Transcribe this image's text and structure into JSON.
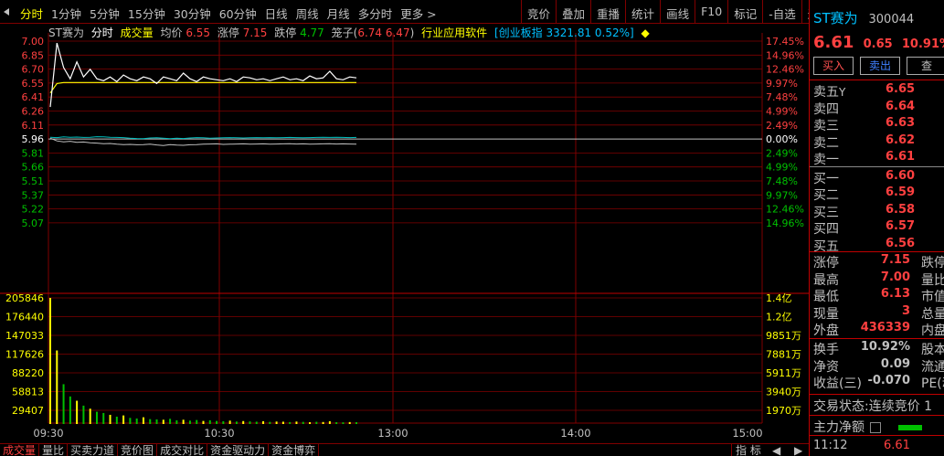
{
  "toolbar": {
    "periods": [
      "分时",
      "1分钟",
      "5分钟",
      "15分钟",
      "30分钟",
      "60分钟",
      "日线",
      "周线",
      "月线",
      "多分时",
      "更多 >"
    ],
    "active_period": 0,
    "tools": [
      "竞价",
      "叠加",
      "重播",
      "统计",
      "画线",
      "F10",
      "标记",
      "-自选",
      "返回"
    ]
  },
  "info_bar": {
    "stock_name": "ST赛为",
    "chart_mode": "分时",
    "volume_label": "成交量",
    "avg_label": "均价",
    "avg_value": "6.55",
    "limit_up_label": "涨停",
    "limit_up_value": "7.15",
    "limit_down_label": "跌停",
    "limit_down_value": "4.77",
    "cage_label": "笼子(",
    "cage_values": "6.74 6.47",
    "cage_close": ")",
    "industry": "行业应用软件",
    "index_text": "[创业板指",
    "index_value": "3321.81 0.52%]"
  },
  "right_panel": {
    "stock_name": "ST赛为",
    "stock_code": "300044",
    "price": "6.61",
    "change": "0.65",
    "change_pct": "10.91%",
    "buy_button": "买入",
    "sell_button": "卖出",
    "query_button": "查",
    "asks": [
      {
        "label": "卖五",
        "tag": "Y",
        "price": "6.65"
      },
      {
        "label": "卖四",
        "price": "6.64"
      },
      {
        "label": "卖三",
        "price": "6.63"
      },
      {
        "label": "卖二",
        "price": "6.62"
      },
      {
        "label": "卖一",
        "price": "6.61"
      }
    ],
    "bids": [
      {
        "label": "买一",
        "price": "6.60"
      },
      {
        "label": "买二",
        "price": "6.59"
      },
      {
        "label": "买三",
        "price": "6.58"
      },
      {
        "label": "买四",
        "price": "6.57"
      },
      {
        "label": "买五",
        "price": "6.56"
      }
    ],
    "stats_a": [
      {
        "label": "涨停",
        "value": "7.15",
        "r2": "跌停"
      },
      {
        "label": "最高",
        "value": "7.00",
        "r2": "量比"
      },
      {
        "label": "最低",
        "value": "6.13",
        "r2": "市值"
      },
      {
        "label": "现量",
        "value": "3",
        "r2": "总量"
      },
      {
        "label": "外盘",
        "value": "436339",
        "r2": "内盘"
      }
    ],
    "stats_b": [
      {
        "label": "换手",
        "value": "10.92%",
        "r2": "股本"
      },
      {
        "label": "净资",
        "value": "0.09",
        "r2": "流通"
      },
      {
        "label": "收益(三)",
        "value": "-0.070",
        "r2": "PE(动"
      }
    ],
    "trade_status_label": "交易状态:",
    "trade_status_value": "连续竞价 1",
    "net_flow_label": "主力净额",
    "last_time": "11:12",
    "last_price": "6.61"
  },
  "chart_data": {
    "type": "line",
    "price_axis_left": [
      "7.00",
      "6.85",
      "6.70",
      "6.55",
      "6.41",
      "6.26",
      "6.11",
      "5.96",
      "5.81",
      "5.66",
      "5.51",
      "5.37",
      "5.22",
      "5.07"
    ],
    "price_axis_right": [
      "17.45%",
      "14.96%",
      "12.46%",
      "9.97%",
      "7.48%",
      "4.99%",
      "2.49%",
      "0.00%",
      "2.49%",
      "4.99%",
      "7.48%",
      "9.97%",
      "12.46%",
      "14.96%"
    ],
    "prev_close": 5.96,
    "volume_axis_left": [
      "205846",
      "176440",
      "147033",
      "117626",
      "88220",
      "58813",
      "29407"
    ],
    "volume_axis_right": [
      "1.4亿",
      "1.2亿",
      "9851万",
      "7881万",
      "5911万",
      "3940万",
      "1970万"
    ],
    "time_labels": [
      "09:30",
      "10:30",
      "13:00",
      "14:00",
      "15:00"
    ],
    "price_series": [
      6.3,
      6.98,
      6.72,
      6.6,
      6.78,
      6.62,
      6.7,
      6.6,
      6.58,
      6.62,
      6.57,
      6.64,
      6.6,
      6.58,
      6.62,
      6.6,
      6.55,
      6.62,
      6.6,
      6.58,
      6.66,
      6.6,
      6.57,
      6.62,
      6.6,
      6.59,
      6.58,
      6.6,
      6.57,
      6.62,
      6.61,
      6.59,
      6.6,
      6.58,
      6.6,
      6.62,
      6.59,
      6.6,
      6.58,
      6.63,
      6.6,
      6.61,
      6.68,
      6.6,
      6.59,
      6.62,
      6.61
    ],
    "avg_series": [
      6.45,
      6.55,
      6.56,
      6.56,
      6.56,
      6.56,
      6.56,
      6.56,
      6.56,
      6.56,
      6.56,
      6.56,
      6.56,
      6.56,
      6.56,
      6.56,
      6.56,
      6.56,
      6.56,
      6.56,
      6.56,
      6.56,
      6.56,
      6.56,
      6.56,
      6.56,
      6.56,
      6.56,
      6.56,
      6.56,
      6.56,
      6.56,
      6.56,
      6.56,
      6.56,
      6.56,
      6.56,
      6.56,
      6.56,
      6.56,
      6.56,
      6.56,
      6.56,
      6.56,
      6.56,
      6.56,
      6.56
    ],
    "index_series": [
      0.1,
      0.08,
      0.12,
      0.1,
      0.11,
      0.09,
      0.1,
      0.13,
      0.12,
      0.1,
      0.09,
      0.08,
      0.05,
      0.03,
      0.02,
      0.06,
      0.07,
      0.05,
      0.02,
      0.05,
      0.03,
      0.06,
      0.08,
      0.07,
      0.05,
      0.06,
      0.07,
      0.08,
      0.07,
      0.06,
      0.07,
      0.08,
      0.07,
      0.08,
      0.07,
      0.08,
      0.09,
      0.08,
      0.07,
      0.08,
      0.09,
      0.1,
      0.09,
      0.1,
      0.09,
      0.08,
      0.09
    ],
    "index2_series": [
      0.05,
      -0.1,
      -0.15,
      -0.12,
      -0.18,
      -0.16,
      -0.2,
      -0.22,
      -0.25,
      -0.24,
      -0.28,
      -0.3,
      -0.29,
      -0.31,
      -0.3,
      -0.28,
      -0.32,
      -0.35,
      -0.3,
      -0.33,
      -0.34,
      -0.31,
      -0.3,
      -0.28,
      -0.27,
      -0.26,
      -0.29,
      -0.28,
      -0.27,
      -0.26,
      -0.28,
      -0.27,
      -0.26,
      -0.28,
      -0.27,
      -0.26,
      -0.25,
      -0.27,
      -0.26,
      -0.28,
      -0.27,
      -0.26,
      -0.25,
      -0.27,
      -0.26,
      -0.27,
      -0.28
    ],
    "volume_series": [
      205846,
      120000,
      65000,
      45000,
      38000,
      30000,
      25000,
      20000,
      18000,
      15000,
      12000,
      14000,
      10000,
      9000,
      11000,
      8000,
      7500,
      7000,
      8500,
      6000,
      7000,
      5500,
      6500,
      5000,
      6000,
      5000,
      4500,
      5500,
      4000,
      4800,
      4200,
      3800,
      4500,
      3500,
      4000,
      3800,
      3200,
      4000,
      3500,
      3000,
      3600,
      3300,
      4500,
      3000,
      2800,
      3200,
      3000
    ]
  },
  "bottom_tabs": [
    "成交量",
    "量比",
    "买卖力道",
    "竞价图",
    "成交对比",
    "资金驱动力",
    "资金博弈"
  ],
  "bottom_index": "指 标",
  "colors": {
    "up": "#ff4040",
    "down": "#00c000",
    "grid": "#800000",
    "price_line": "#ffffff",
    "avg_line": "#ffff00",
    "accent": "#00c0ff"
  }
}
